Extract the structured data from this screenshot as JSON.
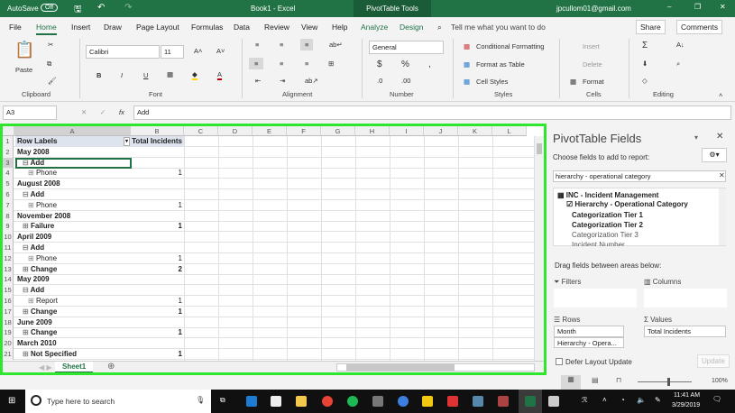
{
  "titlebar": {
    "autosave": "AutoSave",
    "autosave_state": "Off",
    "title": "Book1 - Excel",
    "context": "PivotTable Tools",
    "user": "jpcullom01@gmail.com"
  },
  "tabs": [
    "File",
    "Home",
    "Insert",
    "Draw",
    "Page Layout",
    "Formulas",
    "Data",
    "Review",
    "View",
    "Help",
    "Analyze",
    "Design"
  ],
  "tell_me": "Tell me what you want to do",
  "share": "Share",
  "comments": "Comments",
  "ribbon": {
    "paste": "Paste",
    "font": "Calibri",
    "size": "11",
    "number_format": "General",
    "cond_format": "Conditional Formatting",
    "format_table": "Format as Table",
    "cell_styles": "Cell Styles",
    "insert": "Insert",
    "delete": "Delete",
    "format": "Format",
    "groups": [
      "Clipboard",
      "Font",
      "Alignment",
      "Number",
      "Styles",
      "Cells",
      "Editing"
    ]
  },
  "formula": {
    "name_box": "A3",
    "fx": "fx",
    "value": "Add"
  },
  "columns": [
    "A",
    "B",
    "C",
    "D",
    "E",
    "F",
    "G",
    "H",
    "I",
    "J",
    "K",
    "L"
  ],
  "rows": [
    {
      "n": "1",
      "a": "Row Labels",
      "b": "Total Incidents",
      "lvl": 0
    },
    {
      "n": "2",
      "a": "May 2008",
      "b": "",
      "lvl": 0
    },
    {
      "n": "3",
      "a": "Add",
      "b": "",
      "lvl": 1,
      "icon": "⊟"
    },
    {
      "n": "4",
      "a": "Phone",
      "b": "1",
      "lvl": 2,
      "icon": "⊞"
    },
    {
      "n": "5",
      "a": "August 2008",
      "b": "",
      "lvl": 0
    },
    {
      "n": "6",
      "a": "Add",
      "b": "",
      "lvl": 1,
      "icon": "⊟"
    },
    {
      "n": "7",
      "a": "Phone",
      "b": "1",
      "lvl": 2,
      "icon": "⊞"
    },
    {
      "n": "8",
      "a": "November 2008",
      "b": "",
      "lvl": 0
    },
    {
      "n": "9",
      "a": "Failure",
      "b": "1",
      "lvl": 1,
      "icon": "⊞"
    },
    {
      "n": "10",
      "a": "April 2009",
      "b": "",
      "lvl": 0
    },
    {
      "n": "11",
      "a": "Add",
      "b": "",
      "lvl": 1,
      "icon": "⊟"
    },
    {
      "n": "12",
      "a": "Phone",
      "b": "1",
      "lvl": 2,
      "icon": "⊞"
    },
    {
      "n": "13",
      "a": "Change",
      "b": "2",
      "lvl": 1,
      "icon": "⊞"
    },
    {
      "n": "14",
      "a": "May 2009",
      "b": "",
      "lvl": 0
    },
    {
      "n": "15",
      "a": "Add",
      "b": "",
      "lvl": 1,
      "icon": "⊟"
    },
    {
      "n": "16",
      "a": "Report",
      "b": "1",
      "lvl": 2,
      "icon": "⊞"
    },
    {
      "n": "17",
      "a": "Change",
      "b": "1",
      "lvl": 1,
      "icon": "⊞"
    },
    {
      "n": "18",
      "a": "June 2009",
      "b": "",
      "lvl": 0
    },
    {
      "n": "19",
      "a": "Change",
      "b": "1",
      "lvl": 1,
      "icon": "⊞"
    },
    {
      "n": "20",
      "a": "March 2010",
      "b": "",
      "lvl": 0
    },
    {
      "n": "21",
      "a": "Not Specified",
      "b": "1",
      "lvl": 1,
      "icon": "⊞"
    }
  ],
  "sheet_tab": "Sheet1",
  "panel": {
    "title": "PivotTable Fields",
    "choose": "Choose fields to add to report:",
    "search": "hierarchy - operational category",
    "fields": [
      "INC - Incident Management",
      "Hierarchy - Operational Category",
      "Categorization Tier 1",
      "Categorization Tier 2",
      "Categorization Tier 3",
      "Incident Number"
    ],
    "drag": "Drag fields between areas below:",
    "filters": "Filters",
    "columns": "Columns",
    "rows": "Rows",
    "values": "Values",
    "row_items": [
      "Month",
      "Hierarchy - Opera..."
    ],
    "value_items": [
      "Total Incidents"
    ],
    "defer": "Defer Layout Update",
    "update": "Update"
  },
  "status": {
    "zoom": "100%"
  },
  "taskbar": {
    "search": "Type here to search",
    "time": "11:41 AM",
    "date": "3/29/2019"
  }
}
